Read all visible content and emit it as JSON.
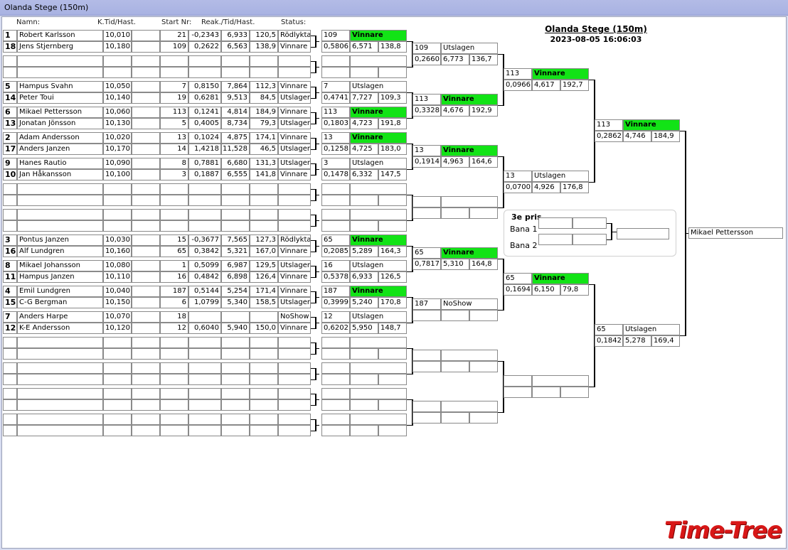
{
  "window": {
    "title": "Olanda Stege (150m)"
  },
  "event": {
    "title": "Olanda Stege (150m)",
    "datetime": "2023-08-05 16:06:03"
  },
  "headers": {
    "name": "Namn:",
    "ktid": "K.Tid/Hast.",
    "start": "Start Nr:",
    "reak": "Reak./Tid/Hast.",
    "status": "Status:"
  },
  "round1": [
    {
      "seed": "1",
      "name": "Robert Karlsson",
      "ktid": "10,010",
      "start": "21",
      "reak": "-0,2343",
      "tid": "6,933",
      "hast": "120,5",
      "status": "Rödlykta"
    },
    {
      "seed": "18",
      "name": "Jens Stjernberg",
      "ktid": "10,180",
      "start": "109",
      "reak": "0,2622",
      "tid": "6,563",
      "hast": "138,9",
      "status": "Vinnare"
    },
    {
      "seed": "",
      "name": "",
      "ktid": "",
      "start": "",
      "reak": "",
      "tid": "",
      "hast": "",
      "status": ""
    },
    {
      "seed": "",
      "name": "",
      "ktid": "",
      "start": "",
      "reak": "",
      "tid": "",
      "hast": "",
      "status": ""
    },
    {
      "seed": "5",
      "name": "Hampus Svahn",
      "ktid": "10,050",
      "start": "7",
      "reak": "0,8150",
      "tid": "7,864",
      "hast": "112,3",
      "status": "Vinnare"
    },
    {
      "seed": "14",
      "name": "Peter Toui",
      "ktid": "10,140",
      "start": "19",
      "reak": "0,6281",
      "tid": "9,513",
      "hast": "84,5",
      "status": "Utslagen"
    },
    {
      "seed": "6",
      "name": "Mikael Pettersson",
      "ktid": "10,060",
      "start": "113",
      "reak": "0,1241",
      "tid": "4,814",
      "hast": "184,9",
      "status": "Vinnare"
    },
    {
      "seed": "13",
      "name": "Jonatan Jönsson",
      "ktid": "10,130",
      "start": "5",
      "reak": "0,4005",
      "tid": "8,734",
      "hast": "79,3",
      "status": "Utslagen"
    },
    {
      "seed": "2",
      "name": "Adam Andersson",
      "ktid": "10,020",
      "start": "13",
      "reak": "0,1024",
      "tid": "4,875",
      "hast": "174,1",
      "status": "Vinnare"
    },
    {
      "seed": "17",
      "name": "Anders Janzen",
      "ktid": "10,170",
      "start": "14",
      "reak": "1,4218",
      "tid": "11,528",
      "hast": "46,5",
      "status": "Utslagen"
    },
    {
      "seed": "9",
      "name": "Hanes Rautio",
      "ktid": "10,090",
      "start": "8",
      "reak": "0,7881",
      "tid": "6,680",
      "hast": "131,3",
      "status": "Utslagen"
    },
    {
      "seed": "10",
      "name": "Jan Håkansson",
      "ktid": "10,100",
      "start": "3",
      "reak": "0,1887",
      "tid": "6,555",
      "hast": "141,8",
      "status": "Vinnare"
    },
    {
      "seed": "",
      "name": "",
      "ktid": "",
      "start": "",
      "reak": "",
      "tid": "",
      "hast": "",
      "status": ""
    },
    {
      "seed": "",
      "name": "",
      "ktid": "",
      "start": "",
      "reak": "",
      "tid": "",
      "hast": "",
      "status": ""
    },
    {
      "seed": "",
      "name": "",
      "ktid": "",
      "start": "",
      "reak": "",
      "tid": "",
      "hast": "",
      "status": ""
    },
    {
      "seed": "",
      "name": "",
      "ktid": "",
      "start": "",
      "reak": "",
      "tid": "",
      "hast": "",
      "status": ""
    },
    {
      "seed": "3",
      "name": "Pontus Janzen",
      "ktid": "10,030",
      "start": "15",
      "reak": "-0,3677",
      "tid": "7,565",
      "hast": "127,3",
      "status": "Rödlykta"
    },
    {
      "seed": "16",
      "name": "Alf Lundgren",
      "ktid": "10,160",
      "start": "65",
      "reak": "0,3842",
      "tid": "5,321",
      "hast": "167,0",
      "status": "Vinnare"
    },
    {
      "seed": "8",
      "name": "Mikael Johansson",
      "ktid": "10,080",
      "start": "1",
      "reak": "0,5099",
      "tid": "6,987",
      "hast": "129,5",
      "status": "Utslagen"
    },
    {
      "seed": "11",
      "name": "Hampus Janzen",
      "ktid": "10,110",
      "start": "16",
      "reak": "0,4842",
      "tid": "6,898",
      "hast": "126,4",
      "status": "Vinnare"
    },
    {
      "seed": "4",
      "name": "Emil Lundgren",
      "ktid": "10,040",
      "start": "187",
      "reak": "0,5144",
      "tid": "5,254",
      "hast": "171,4",
      "status": "Vinnare"
    },
    {
      "seed": "15",
      "name": "C-G Bergman",
      "ktid": "10,150",
      "start": "6",
      "reak": "1,0799",
      "tid": "5,340",
      "hast": "158,5",
      "status": "Utslagen"
    },
    {
      "seed": "7",
      "name": "Anders Harpe",
      "ktid": "10,070",
      "start": "18",
      "reak": "",
      "tid": "",
      "hast": "",
      "status": "NoShow"
    },
    {
      "seed": "12",
      "name": "K-E Andersson",
      "ktid": "10,120",
      "start": "12",
      "reak": "0,6040",
      "tid": "5,940",
      "hast": "150,0",
      "status": "Vinnare"
    },
    {
      "seed": "",
      "name": "",
      "ktid": "",
      "start": "",
      "reak": "",
      "tid": "",
      "hast": "",
      "status": ""
    },
    {
      "seed": "",
      "name": "",
      "ktid": "",
      "start": "",
      "reak": "",
      "tid": "",
      "hast": "",
      "status": ""
    },
    {
      "seed": "",
      "name": "",
      "ktid": "",
      "start": "",
      "reak": "",
      "tid": "",
      "hast": "",
      "status": ""
    },
    {
      "seed": "",
      "name": "",
      "ktid": "",
      "start": "",
      "reak": "",
      "tid": "",
      "hast": "",
      "status": ""
    },
    {
      "seed": "",
      "name": "",
      "ktid": "",
      "start": "",
      "reak": "",
      "tid": "",
      "hast": "",
      "status": ""
    },
    {
      "seed": "",
      "name": "",
      "ktid": "",
      "start": "",
      "reak": "",
      "tid": "",
      "hast": "",
      "status": ""
    },
    {
      "seed": "",
      "name": "",
      "ktid": "",
      "start": "",
      "reak": "",
      "tid": "",
      "hast": "",
      "status": ""
    },
    {
      "seed": "",
      "name": "",
      "ktid": "",
      "start": "",
      "reak": "",
      "tid": "",
      "hast": "",
      "status": ""
    }
  ],
  "round2": [
    {
      "nr": "109",
      "status": "Vinnare",
      "reak": "0,5806",
      "tid": "6,571",
      "hast": "138,8"
    },
    {
      "nr": "",
      "status": "",
      "reak": "",
      "tid": "",
      "hast": ""
    },
    {
      "nr": "7",
      "status": "Utslagen",
      "reak": "0,4741",
      "tid": "7,727",
      "hast": "109,3"
    },
    {
      "nr": "113",
      "status": "Vinnare",
      "reak": "0,1803",
      "tid": "4,723",
      "hast": "191,8"
    },
    {
      "nr": "13",
      "status": "Vinnare",
      "reak": "0,1258",
      "tid": "4,725",
      "hast": "183,0"
    },
    {
      "nr": "3",
      "status": "Utslagen",
      "reak": "0,1478",
      "tid": "6,332",
      "hast": "147,5"
    },
    {
      "nr": "",
      "status": "",
      "reak": "",
      "tid": "",
      "hast": ""
    },
    {
      "nr": "",
      "status": "",
      "reak": "",
      "tid": "",
      "hast": ""
    },
    {
      "nr": "65",
      "status": "Vinnare",
      "reak": "0,2085",
      "tid": "5,289",
      "hast": "164,3"
    },
    {
      "nr": "16",
      "status": "Utslagen",
      "reak": "0,5378",
      "tid": "6,933",
      "hast": "126,5"
    },
    {
      "nr": "187",
      "status": "Vinnare",
      "reak": "0,3999",
      "tid": "5,240",
      "hast": "170,8"
    },
    {
      "nr": "12",
      "status": "Utslagen",
      "reak": "0,6202",
      "tid": "5,950",
      "hast": "148,7"
    },
    {
      "nr": "",
      "status": "",
      "reak": "",
      "tid": "",
      "hast": ""
    },
    {
      "nr": "",
      "status": "",
      "reak": "",
      "tid": "",
      "hast": ""
    },
    {
      "nr": "",
      "status": "",
      "reak": "",
      "tid": "",
      "hast": ""
    },
    {
      "nr": "",
      "status": "",
      "reak": "",
      "tid": "",
      "hast": ""
    }
  ],
  "round3": [
    {
      "nr": "109",
      "status": "Utslagen",
      "reak": "0,2660",
      "tid": "6,773",
      "hast": "136,7"
    },
    {
      "nr": "113",
      "status": "Vinnare",
      "reak": "0,3328",
      "tid": "4,676",
      "hast": "192,9"
    },
    {
      "nr": "13",
      "status": "Vinnare",
      "reak": "0,1914",
      "tid": "4,963",
      "hast": "164,6"
    },
    {
      "nr": "",
      "status": "",
      "reak": "",
      "tid": "",
      "hast": ""
    },
    {
      "nr": "65",
      "status": "Vinnare",
      "reak": "0,7817",
      "tid": "5,310",
      "hast": "164,8"
    },
    {
      "nr": "187",
      "status": "NoShow",
      "reak": "",
      "tid": "",
      "hast": ""
    },
    {
      "nr": "",
      "status": "",
      "reak": "",
      "tid": "",
      "hast": ""
    },
    {
      "nr": "",
      "status": "",
      "reak": "",
      "tid": "",
      "hast": ""
    }
  ],
  "round4": [
    {
      "nr": "113",
      "status": "Vinnare",
      "reak": "0,0966",
      "tid": "4,617",
      "hast": "192,7"
    },
    {
      "nr": "13",
      "status": "Utslagen",
      "reak": "0,0700",
      "tid": "4,926",
      "hast": "176,8"
    },
    {
      "nr": "65",
      "status": "Vinnare",
      "reak": "0,1694",
      "tid": "6,150",
      "hast": "79,8"
    },
    {
      "nr": "",
      "status": "",
      "reak": "",
      "tid": "",
      "hast": ""
    }
  ],
  "round5": [
    {
      "nr": "113",
      "status": "Vinnare",
      "reak": "0,2862",
      "tid": "4,746",
      "hast": "184,9"
    },
    {
      "nr": "65",
      "status": "Utslagen",
      "reak": "0,1842",
      "tid": "5,278",
      "hast": "169,4"
    }
  ],
  "winner": "Mikael Pettersson",
  "third_place": {
    "title": "3e pris",
    "lane1": "Bana 1",
    "lane2": "Bana 2"
  },
  "logo": "Time-Tree",
  "colors": {
    "winner_bg": "#12e316",
    "window_bg": "#d7dcf0",
    "logo": "#d81717"
  }
}
